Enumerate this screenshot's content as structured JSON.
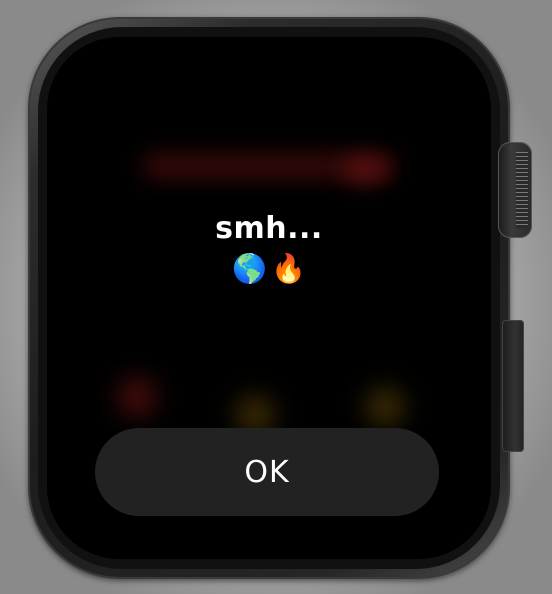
{
  "alert": {
    "title": "smh...",
    "emojis": {
      "globe": "🌎",
      "fire": "🔥"
    },
    "ok_label": "OK"
  },
  "colors": {
    "screen_background": "#000000",
    "button_background": "#222222",
    "text": "#ffffff"
  }
}
